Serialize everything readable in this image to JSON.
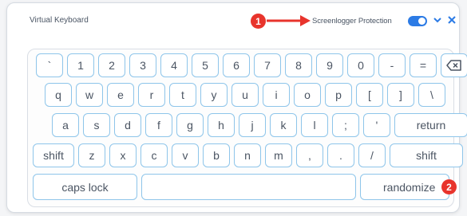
{
  "window": {
    "title": "Virtual Keyboard",
    "protection_label": "Screenlogger Protection",
    "protection_enabled": true,
    "toggle_color": "#2c7be5",
    "icons": [
      "chevron-down-icon",
      "close-icon"
    ]
  },
  "annotations": {
    "marker1": "1",
    "marker2": "2",
    "marker_color": "#e8342c"
  },
  "keyboard": {
    "row1": [
      "`",
      "1",
      "2",
      "3",
      "4",
      "5",
      "6",
      "7",
      "8",
      "9",
      "0",
      "-",
      "="
    ],
    "row2": [
      "q",
      "w",
      "e",
      "r",
      "t",
      "y",
      "u",
      "i",
      "o",
      "p",
      "[",
      "]",
      "\\"
    ],
    "row3": [
      "a",
      "s",
      "d",
      "f",
      "g",
      "h",
      "j",
      "k",
      "l",
      ";",
      "'"
    ],
    "row4": [
      "z",
      "x",
      "c",
      "v",
      "b",
      "n",
      "m",
      ",",
      ".",
      "/"
    ],
    "return_label": "return",
    "shift_label": "shift",
    "caps_label": "caps lock",
    "randomize_label": "randomize",
    "space_label": ""
  }
}
